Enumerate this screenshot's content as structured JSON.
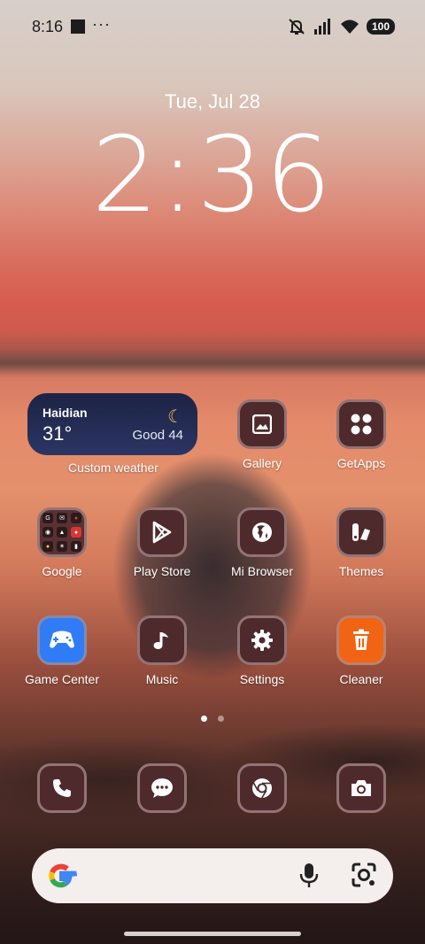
{
  "status": {
    "time": "8:16",
    "dots": "···",
    "battery": "100"
  },
  "lock": {
    "date": "Tue, Jul 28",
    "time": "2:36"
  },
  "weather": {
    "city": "Haidian",
    "temp": "31°",
    "air_quality": "Good 44",
    "label": "Custom weather"
  },
  "apps": {
    "gallery": "Gallery",
    "getapps": "GetApps",
    "google": "Google",
    "play_store": "Play Store",
    "mi_browser": "Mi Browser",
    "themes": "Themes",
    "game_center": "Game Center",
    "music": "Music",
    "settings": "Settings",
    "cleaner": "Cleaner"
  },
  "dock": {
    "phone": "phone-icon",
    "messages": "messages-icon",
    "chrome": "chrome-icon",
    "camera": "camera-icon"
  },
  "pages": {
    "count": 2,
    "active": 1
  },
  "colors": {
    "accent": "#4f2a2c",
    "weather_bg": "#1d2345",
    "cleaner": "#f06414",
    "game_center": "#2f7cf6"
  }
}
